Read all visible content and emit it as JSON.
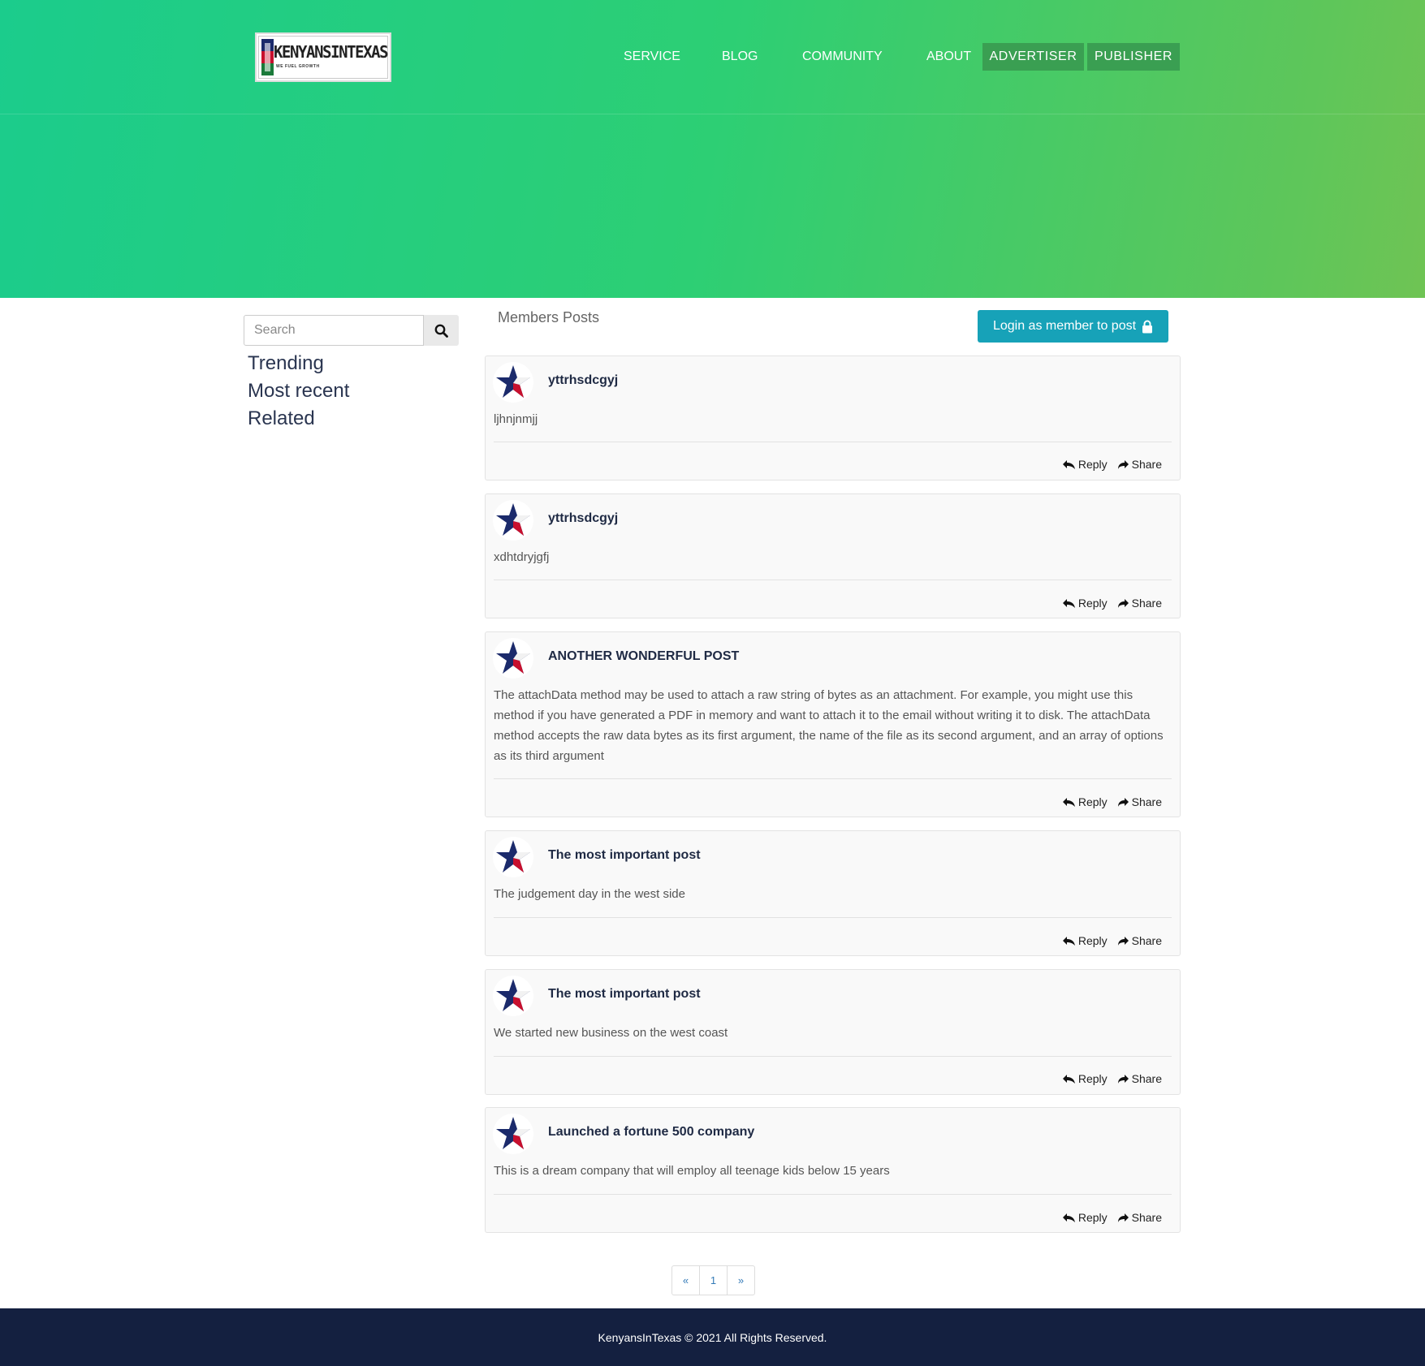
{
  "header": {
    "logo": {
      "brand": "KENYANSINTEXAS",
      "tagline": "WE FUEL GROWTH"
    },
    "nav": [
      "SERVICE",
      "BLOG",
      "COMMUNITY",
      "ABOUT"
    ],
    "buttons": [
      "ADVERTISER",
      "PUBLISHER"
    ]
  },
  "sidebar": {
    "search_placeholder": "Search",
    "links": [
      "Trending",
      "Most recent",
      "Related"
    ]
  },
  "main": {
    "title": "Members Posts",
    "login_label": "Login as member to post",
    "reply_label": "Reply",
    "share_label": "Share",
    "posts": [
      {
        "title": "yttrhsdcgyj",
        "body": "ljhnjnmjj"
      },
      {
        "title": "yttrhsdcgyj",
        "body": "xdhtdryjgfj"
      },
      {
        "title": "ANOTHER WONDERFUL POST",
        "body": "The attachData method may be used to attach a raw string of bytes as an attachment. For example, you might use this method if you have generated a PDF in memory and want to attach it to the email without writing it to disk. The attachData method accepts the raw data bytes as its first argument, the name of the file as its second argument, and an array of options as its third argument"
      },
      {
        "title": "The most important post",
        "body": "The judgement day in the west side"
      },
      {
        "title": "The most important post",
        "body": "We started new business on the west coast"
      },
      {
        "title": "Launched a fortune 500 company",
        "body": "This is a dream company that will employ all teenage kids below 15 years"
      }
    ]
  },
  "pagination": {
    "prev": "«",
    "current": "1",
    "next": "»"
  },
  "footer": {
    "text": "KenyansInTexas © 2021 All Rights Reserved."
  },
  "colors": {
    "hero_start": "#1bcc8c",
    "hero_end": "#6fc454",
    "nav_button": "#3a9f52",
    "login_button": "#17a2b8",
    "footer": "#142040"
  },
  "icons": [
    "search-icon",
    "lock-icon",
    "reply-all-icon",
    "share-icon",
    "star-avatar-icon"
  ]
}
